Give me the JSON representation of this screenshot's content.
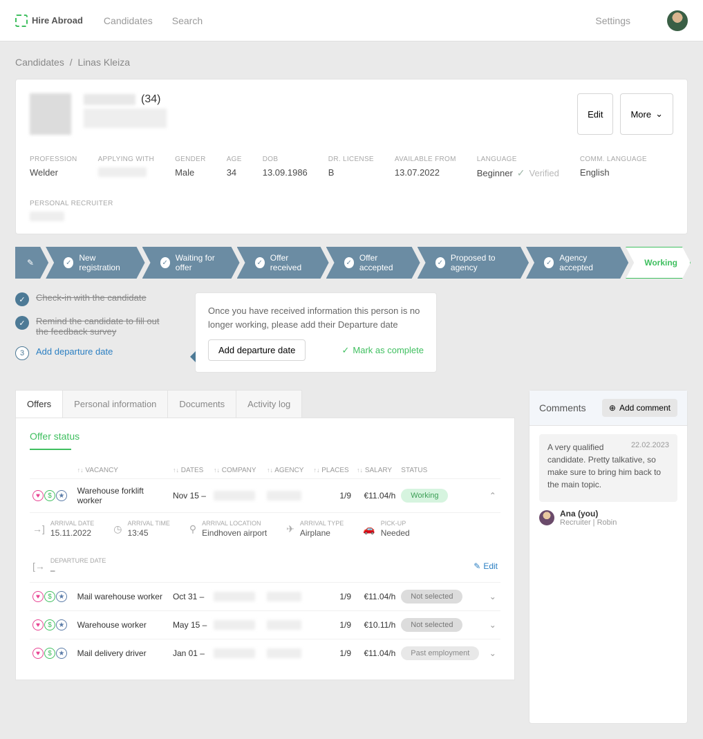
{
  "topbar": {
    "brand": "Hire Abroad",
    "nav": {
      "candidates": "Candidates",
      "search": "Search"
    },
    "settings": "Settings"
  },
  "breadcrumb": {
    "root": "Candidates",
    "current": "Linas Kleiza"
  },
  "profile": {
    "age_display": "(34)",
    "edit": "Edit",
    "more": "More"
  },
  "meta": [
    {
      "label": "PROFESSION",
      "value": "Welder"
    },
    {
      "label": "APPLYING WITH",
      "value": ""
    },
    {
      "label": "GENDER",
      "value": "Male"
    },
    {
      "label": "AGE",
      "value": "34"
    },
    {
      "label": "DOB",
      "value": "13.09.1986"
    },
    {
      "label": "DR. LICENSE",
      "value": "B"
    },
    {
      "label": "AVAILABLE FROM",
      "value": "13.07.2022"
    },
    {
      "label": "LANGUAGE",
      "value": "Beginner",
      "verified": "Verified"
    },
    {
      "label": "COMM. LANGUAGE",
      "value": "English"
    },
    {
      "label": "PERSONAL RECRUITER",
      "value": ""
    }
  ],
  "pipeline": [
    "New registration",
    "Waiting for offer",
    "Offer received",
    "Offer accepted",
    "Proposed to agency",
    "Agency accepted"
  ],
  "pipeline_active": "Working",
  "tasks": [
    {
      "label": "Check-in with the candidate",
      "done": true
    },
    {
      "label": "Remind the candidate to fill out the feedback survey",
      "done": true
    },
    {
      "label": "Add departure date",
      "done": false,
      "num": "3"
    }
  ],
  "callout": {
    "text": "Once you have received information this person is no longer working, please add their Departure date",
    "primary": "Add departure date",
    "secondary": "Mark as complete"
  },
  "tabs": {
    "offers": "Offers",
    "personal": "Personal information",
    "documents": "Documents",
    "activity": "Activity log"
  },
  "offers_section_title": "Offer status",
  "offers_table": {
    "headers": {
      "vacancy": "VACANCY",
      "dates": "DATES",
      "company": "COMPANY",
      "agency": "AGENCY",
      "places": "PLACES",
      "salary": "SALARY",
      "status": "STATUS"
    },
    "rows": [
      {
        "vacancy": "Warehouse forklift worker",
        "dates": "Nov 15 –",
        "places": "1/9",
        "salary": "€11.04/h",
        "status": "Working",
        "status_style": "green",
        "expanded": true
      },
      {
        "vacancy": "Mail warehouse worker",
        "dates": "Oct 31 –",
        "places": "1/9",
        "salary": "€11.04/h",
        "status": "Not selected",
        "status_style": "grey"
      },
      {
        "vacancy": "Warehouse worker",
        "dates": "May 15 –",
        "places": "1/9",
        "salary": "€10.11/h",
        "status": "Not selected",
        "status_style": "grey"
      },
      {
        "vacancy": "Mail delivery driver",
        "dates": "Jan 01 –",
        "places": "1/9",
        "salary": "€11.04/h",
        "status": "Past employment",
        "status_style": "grey2"
      }
    ],
    "details": {
      "arrival_date": {
        "label": "ARRIVAL DATE",
        "value": "15.11.2022"
      },
      "arrival_time": {
        "label": "ARRIVAL TIME",
        "value": "13:45"
      },
      "arrival_location": {
        "label": "ARRIVAL LOCATION",
        "value": "Eindhoven airport"
      },
      "arrival_type": {
        "label": "ARRIVAL TYPE",
        "value": "Airplane"
      },
      "pickup": {
        "label": "PICK-UP",
        "value": "Needed"
      },
      "departure_date": {
        "label": "DEPARTURE DATE",
        "value": "–"
      },
      "edit": "Edit"
    }
  },
  "comments": {
    "title": "Comments",
    "add": "Add comment",
    "items": [
      {
        "text": "A very qualified candidate. Pretty talkative, so make sure to bring him back to the main topic.",
        "date": "22.02.2023",
        "author": "Ana (you)",
        "sub": "Recruiter | Robin"
      }
    ]
  }
}
